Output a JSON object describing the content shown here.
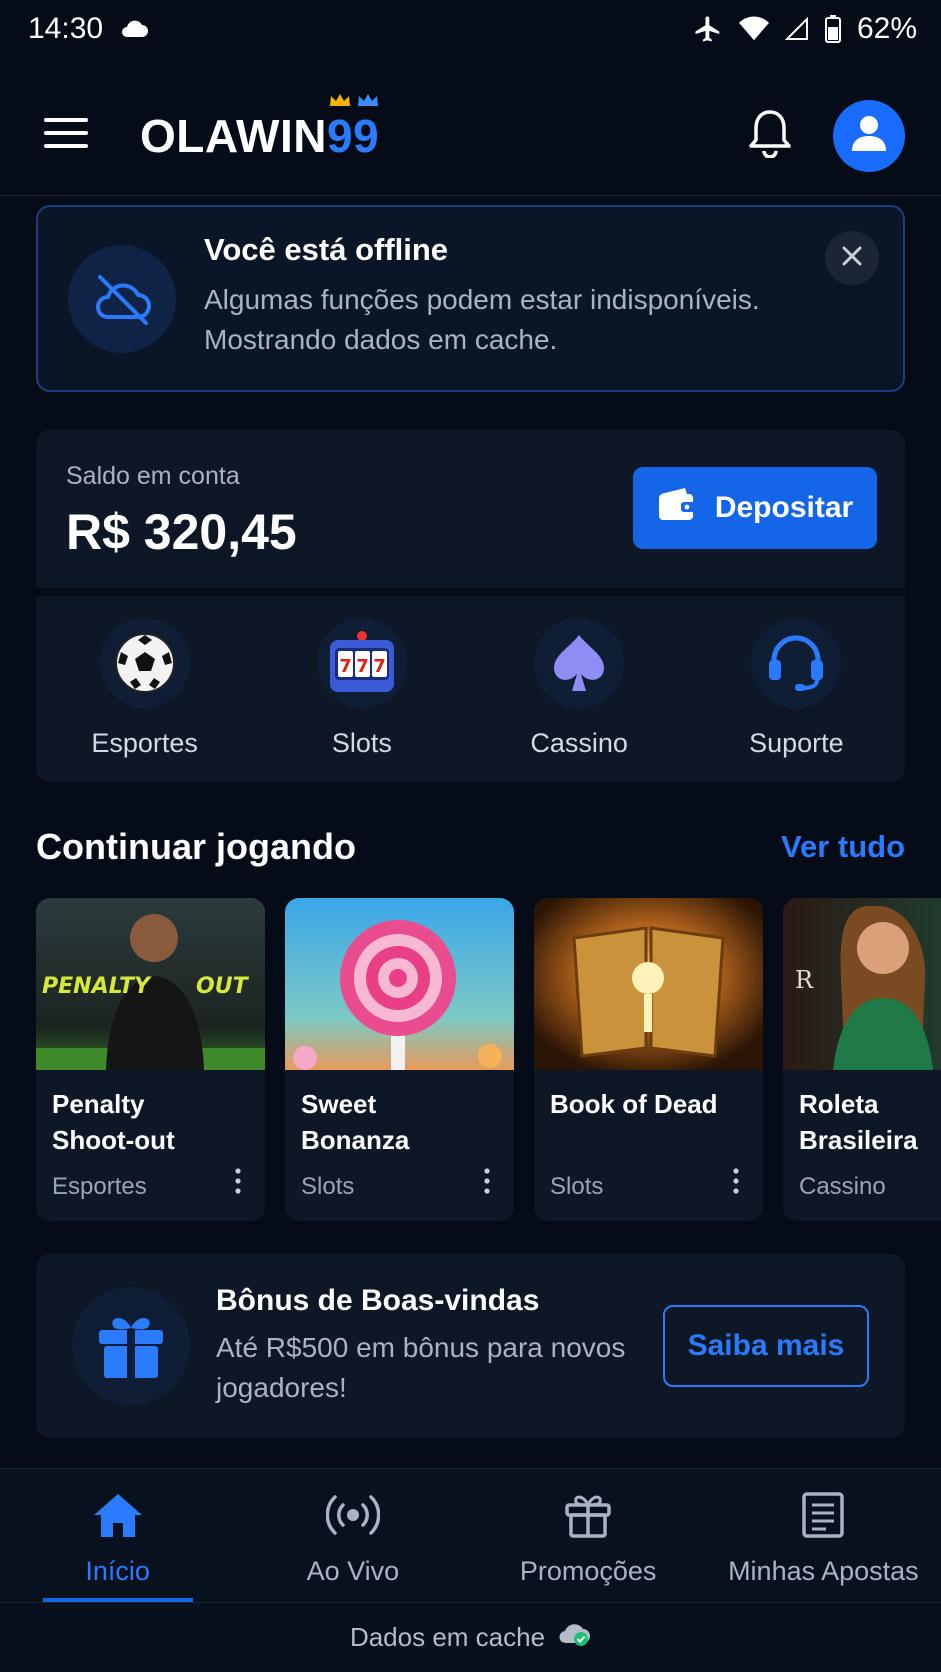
{
  "status_bar": {
    "time": "14:30",
    "battery": "62%"
  },
  "header": {
    "logo_text": "OLAWIN",
    "logo_number": "99"
  },
  "offline_banner": {
    "title": "Você está offline",
    "message": "Algumas funções podem estar indisponíveis. Mostrando dados em cache."
  },
  "balance": {
    "label": "Saldo em conta",
    "amount": "R$ 320,45",
    "deposit_label": "Depositar"
  },
  "quick_links": [
    {
      "label": "Esportes",
      "icon": "soccer-ball-icon"
    },
    {
      "label": "Slots",
      "icon": "slot-machine-icon"
    },
    {
      "label": "Cassino",
      "icon": "spade-icon"
    },
    {
      "label": "Suporte",
      "icon": "headset-icon"
    }
  ],
  "continue": {
    "title": "Continuar jogando",
    "see_all": "Ver tudo",
    "games": [
      {
        "title": "Penalty Shoot-out",
        "category": "Esportes"
      },
      {
        "title": "Sweet Bonanza",
        "category": "Slots"
      },
      {
        "title": "Book of Dead",
        "category": "Slots"
      },
      {
        "title": "Roleta Brasileira",
        "category": "Cassino"
      }
    ]
  },
  "bonus": {
    "title": "Bônus de Boas-vindas",
    "description": "Até R$500 em bônus para novos jogadores!",
    "button": "Saiba mais"
  },
  "bottom_nav": [
    {
      "label": "Início",
      "icon": "home-icon",
      "active": true
    },
    {
      "label": "Ao Vivo",
      "icon": "live-broadcast-icon"
    },
    {
      "label": "Promoções",
      "icon": "gift-icon"
    },
    {
      "label": "Minhas Apostas",
      "icon": "bet-slip-icon"
    }
  ],
  "cache_status": "Dados em cache",
  "colors": {
    "accent": "#1565e8",
    "link": "#2b7bff",
    "background": "#050c17",
    "card": "#0d1726"
  }
}
